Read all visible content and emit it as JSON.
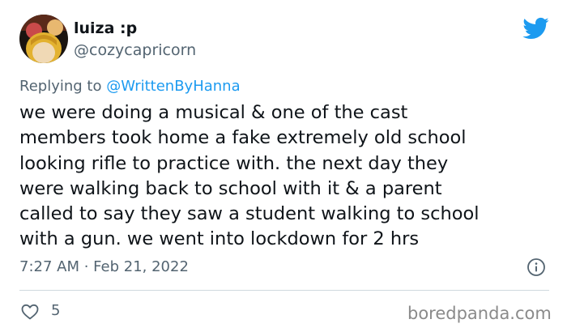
{
  "user": {
    "display_name": "luiza :p",
    "handle": "@cozycapricorn",
    "avatar": "avatar"
  },
  "replying_to": {
    "prefix": "Replying to ",
    "handle": "@WrittenByHanna"
  },
  "tweet": {
    "lines": [
      "we were doing a musical & one of the cast",
      "members took home a fake extremely old school",
      "looking rifle to practice with. the next day they",
      "were walking back to school with it & a parent",
      "called to say they saw a student walking to school",
      "with a gun. we went into lockdown for 2 hrs"
    ]
  },
  "timestamp": "7:27 AM · Feb 21, 2022",
  "like_count": "5",
  "watermark": "boredpanda.com",
  "icons": {
    "brand": "twitter-bird-icon",
    "info": "info-icon",
    "like": "heart-icon"
  },
  "colors": {
    "twitter_blue": "#1d9bf0",
    "secondary_text": "#536471",
    "primary_text": "#0f1419",
    "divider": "#cfd9de"
  }
}
